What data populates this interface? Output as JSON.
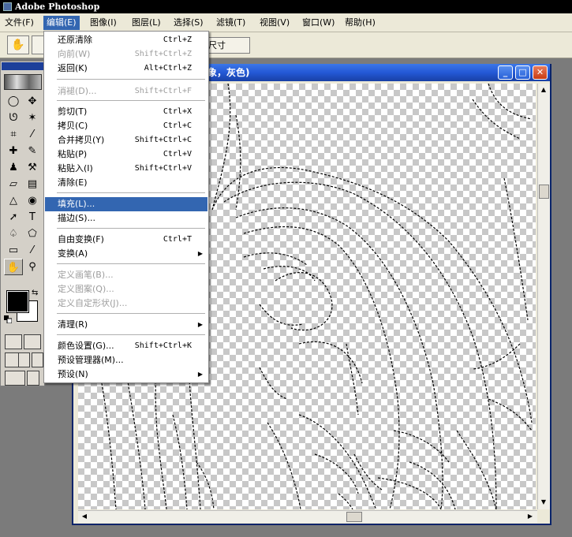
{
  "app": {
    "title": "Adobe Photoshop"
  },
  "menubar": [
    {
      "label": "文件(F)",
      "active": false
    },
    {
      "label": "编辑(E)",
      "active": true
    },
    {
      "label": "图像(I)",
      "active": false
    },
    {
      "label": "图层(L)",
      "active": false
    },
    {
      "label": "选择(S)",
      "active": false
    },
    {
      "label": "滤镜(T)",
      "active": false
    },
    {
      "label": "视图(V)",
      "active": false
    },
    {
      "label": "窗口(W)",
      "active": false
    },
    {
      "label": "帮助(H)",
      "active": false
    }
  ],
  "options_bar": {
    "hand_icon": "hand-icon",
    "size_button_label": "尺寸"
  },
  "document": {
    "title": "象，灰色)",
    "minimize": "_",
    "maximize": "□",
    "close": "✕"
  },
  "edit_menu": {
    "items": [
      {
        "label": "还原清除",
        "shortcut": "Ctrl+Z",
        "disabled": false
      },
      {
        "label": "向前(W)",
        "shortcut": "Shift+Ctrl+Z",
        "disabled": true
      },
      {
        "label": "返回(K)",
        "shortcut": "Alt+Ctrl+Z",
        "disabled": false
      },
      {
        "label": "消褪(D)...",
        "shortcut": "Shift+Ctrl+F",
        "disabled": true
      },
      {
        "label": "剪切(T)",
        "shortcut": "Ctrl+X",
        "disabled": false
      },
      {
        "label": "拷贝(C)",
        "shortcut": "Ctrl+C",
        "disabled": false
      },
      {
        "label": "合并拷贝(Y)",
        "shortcut": "Shift+Ctrl+C",
        "disabled": false
      },
      {
        "label": "粘贴(P)",
        "shortcut": "Ctrl+V",
        "disabled": false
      },
      {
        "label": "粘贴入(I)",
        "shortcut": "Shift+Ctrl+V",
        "disabled": false
      },
      {
        "label": "清除(E)",
        "shortcut": "",
        "disabled": false
      },
      {
        "label": "填充(L)...",
        "shortcut": "",
        "disabled": false,
        "highlighted": true
      },
      {
        "label": "描边(S)...",
        "shortcut": "",
        "disabled": false
      },
      {
        "label": "自由变换(F)",
        "shortcut": "Ctrl+T",
        "disabled": false
      },
      {
        "label": "变换(A)",
        "shortcut": "",
        "disabled": false,
        "submenu": true
      },
      {
        "label": "定义画笔(B)...",
        "shortcut": "",
        "disabled": true
      },
      {
        "label": "定义图案(Q)...",
        "shortcut": "",
        "disabled": true
      },
      {
        "label": "定义自定形状(J)...",
        "shortcut": "",
        "disabled": true
      },
      {
        "label": "清理(R)",
        "shortcut": "",
        "disabled": false,
        "submenu": true
      },
      {
        "label": "颜色设置(G)...",
        "shortcut": "Shift+Ctrl+K",
        "disabled": false
      },
      {
        "label": "预设管理器(M)...",
        "shortcut": "",
        "disabled": false
      },
      {
        "label": "预设(N)",
        "shortcut": "",
        "disabled": false,
        "submenu": true
      }
    ]
  },
  "toolbox": {
    "tools": [
      {
        "name": "marquee-tool-icon",
        "glyph": "◯"
      },
      {
        "name": "move-tool-icon",
        "glyph": "✥"
      },
      {
        "name": "lasso-tool-icon",
        "glyph": "ᘎ"
      },
      {
        "name": "magic-wand-tool-icon",
        "glyph": "✶"
      },
      {
        "name": "crop-tool-icon",
        "glyph": "⌗"
      },
      {
        "name": "eyedropper-slice-icon",
        "glyph": "⁄"
      },
      {
        "name": "healing-brush-icon",
        "glyph": "✚"
      },
      {
        "name": "brush-tool-icon",
        "glyph": "✎"
      },
      {
        "name": "stamp-tool-icon",
        "glyph": "♟"
      },
      {
        "name": "history-brush-icon",
        "glyph": "⚒"
      },
      {
        "name": "eraser-tool-icon",
        "glyph": "▱"
      },
      {
        "name": "gradient-tool-icon",
        "glyph": "▤"
      },
      {
        "name": "blur-tool-icon",
        "glyph": "△"
      },
      {
        "name": "dodge-tool-icon",
        "glyph": "◉"
      },
      {
        "name": "path-select-tool-icon",
        "glyph": "➚"
      },
      {
        "name": "type-tool-icon",
        "glyph": "T"
      },
      {
        "name": "pen-tool-icon",
        "glyph": "♤"
      },
      {
        "name": "shape-tool-icon",
        "glyph": "⬠"
      },
      {
        "name": "notes-tool-icon",
        "glyph": "▭"
      },
      {
        "name": "eyedropper-tool-icon",
        "glyph": "⁄"
      },
      {
        "name": "hand-tool-icon",
        "glyph": "✋"
      },
      {
        "name": "zoom-tool-icon",
        "glyph": "⚲"
      }
    ],
    "foreground_color": "#000000",
    "background_color": "#ffffff",
    "swap_glyph": "⇆"
  }
}
